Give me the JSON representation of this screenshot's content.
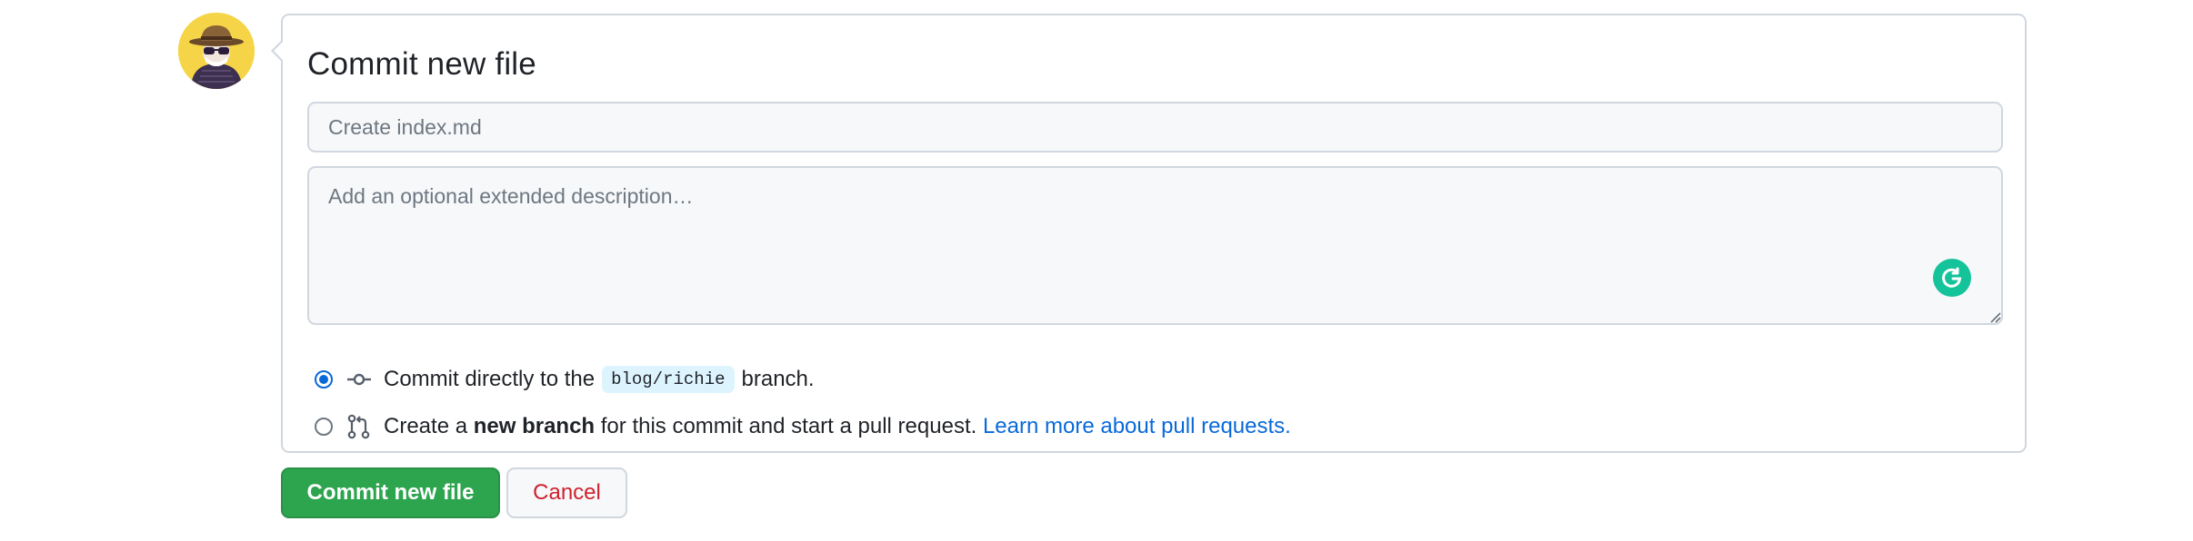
{
  "commit_form": {
    "title": "Commit new file",
    "summary_placeholder": "Create index.md",
    "description_placeholder": "Add an optional extended description…"
  },
  "options": {
    "direct": {
      "selected": true,
      "prefix": "Commit directly to the",
      "branch": "blog/richie",
      "suffix": "branch."
    },
    "new_branch": {
      "selected": false,
      "prefix": "Create a",
      "bold": "new branch",
      "middle": "for this commit and start a pull request.",
      "link": "Learn more about pull requests."
    }
  },
  "buttons": {
    "commit_label": "Commit new file",
    "cancel_label": "Cancel"
  },
  "icons": {
    "avatar": "avatar-hat-sunglasses",
    "commit": "git-commit-icon",
    "pull_request": "git-pull-request-icon",
    "grammarly": "grammarly-icon"
  },
  "colors": {
    "primary_button": "#2da44e",
    "cancel_text": "#cf222e",
    "link": "#0969da",
    "branch_bg": "#ddf4ff"
  }
}
